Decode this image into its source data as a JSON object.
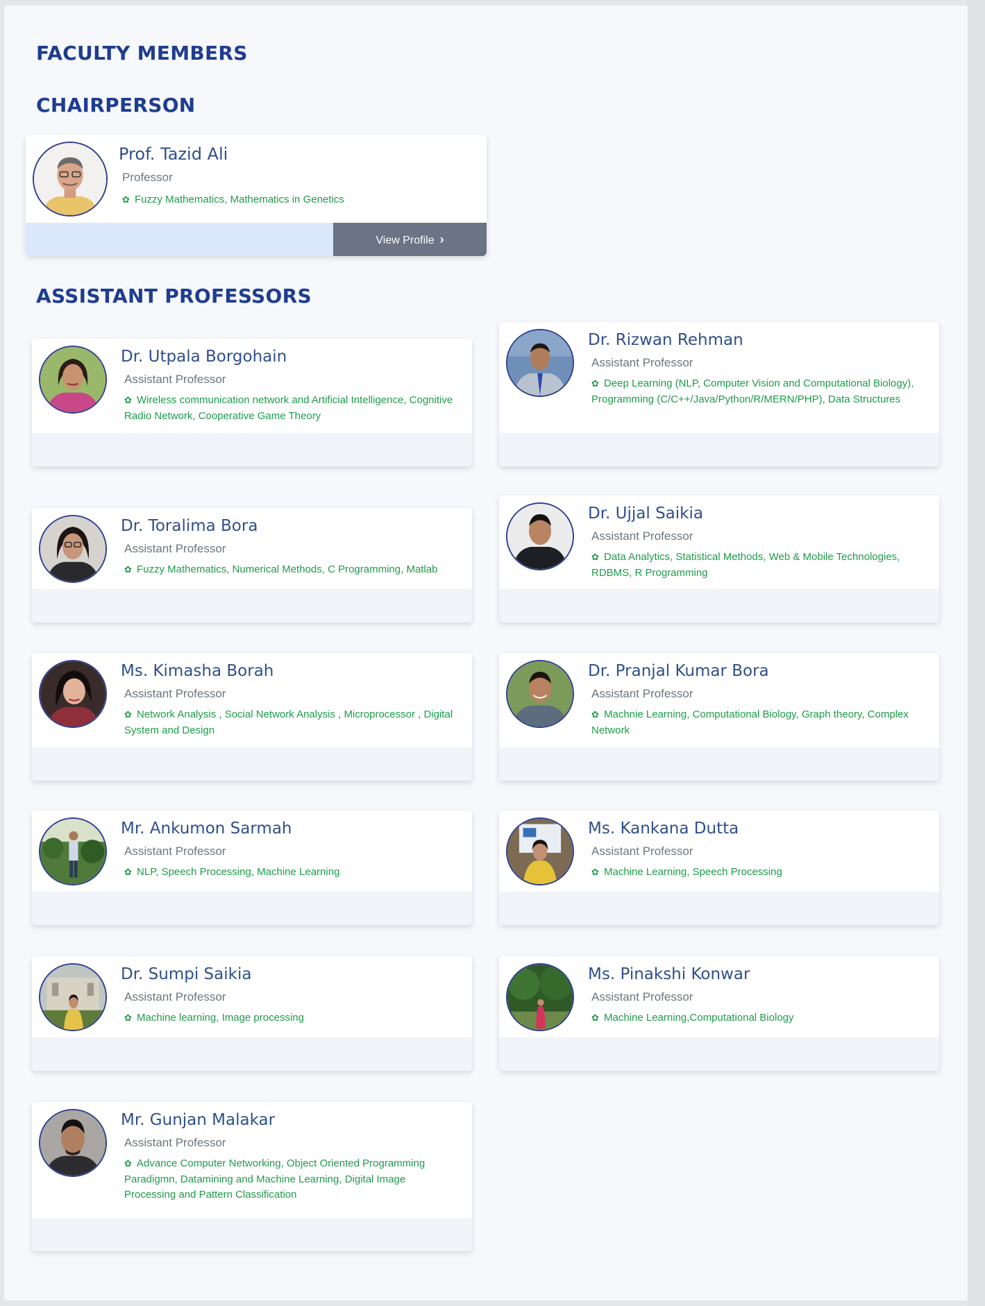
{
  "headings": {
    "faculty": "FACULTY MEMBERS",
    "chairperson": "CHAIRPERSON",
    "assistant": "ASSISTANT PROFESSORS"
  },
  "icons": {
    "specialization": "gear-icon",
    "view_profile": "chevron-right-icon"
  },
  "colors": {
    "heading": "#1f3d8f",
    "name": "#2f4f8c",
    "specialization": "#1f9b4b",
    "button": "#6b7385"
  },
  "chairperson": {
    "name": "Prof. Tazid Ali",
    "role": "Professor",
    "specialization": "Fuzzy Mathematics, Mathematics in Genetics",
    "button_label": "View Profile"
  },
  "faculty": [
    {
      "name": "Dr. Utpala Borgohain",
      "role": "Assistant Professor",
      "specialization": "Wireless communication network and Artificial Intelligence, Cognitive Radio Network, Cooperative Game Theory"
    },
    {
      "name": "Dr. Rizwan Rehman",
      "role": "Assistant Professor",
      "specialization": "Deep Learning (NLP, Computer Vision and Computational Biology), Programming (C/C++/Java/Python/R/MERN/PHP), Data Structures"
    },
    {
      "name": "Dr. Toralima Bora",
      "role": "Assistant Professor",
      "specialization": "Fuzzy Mathematics, Numerical Methods, C Programming, Matlab"
    },
    {
      "name": "Dr. Ujjal Saikia",
      "role": "Assistant Professor",
      "specialization": "Data Analytics, Statistical Methods, Web & Mobile Technologies, RDBMS, R Programming"
    },
    {
      "name": "Ms. Kimasha Borah",
      "role": "Assistant Professor",
      "specialization": "Network Analysis , Social Network Analysis , Microprocessor , Digital System and Design"
    },
    {
      "name": "Dr. Pranjal Kumar Bora",
      "role": "Assistant Professor",
      "specialization": "Machnie Learning, Computational Biology, Graph theory, Complex Network"
    },
    {
      "name": "Mr. Ankumon Sarmah",
      "role": "Assistant Professor",
      "specialization": "NLP, Speech Processing, Machine Learning"
    },
    {
      "name": "Ms. Kankana Dutta",
      "role": "Assistant Professor",
      "specialization": "Machine Learning, Speech Processing"
    },
    {
      "name": "Dr. Sumpi Saikia",
      "role": "Assistant Professor",
      "specialization": "Machine learning, Image processing"
    },
    {
      "name": "Ms. Pinakshi Konwar",
      "role": "Assistant Professor",
      "specialization": "Machine Learning,Computational Biology"
    },
    {
      "name": "Mr. Gunjan Malakar",
      "role": "Assistant Professor",
      "specialization": "Advance Computer Networking, Object Oriented Programming Paradigmn, Datamining and Machine Learning, Digital Image Processing and Pattern Classification"
    }
  ]
}
